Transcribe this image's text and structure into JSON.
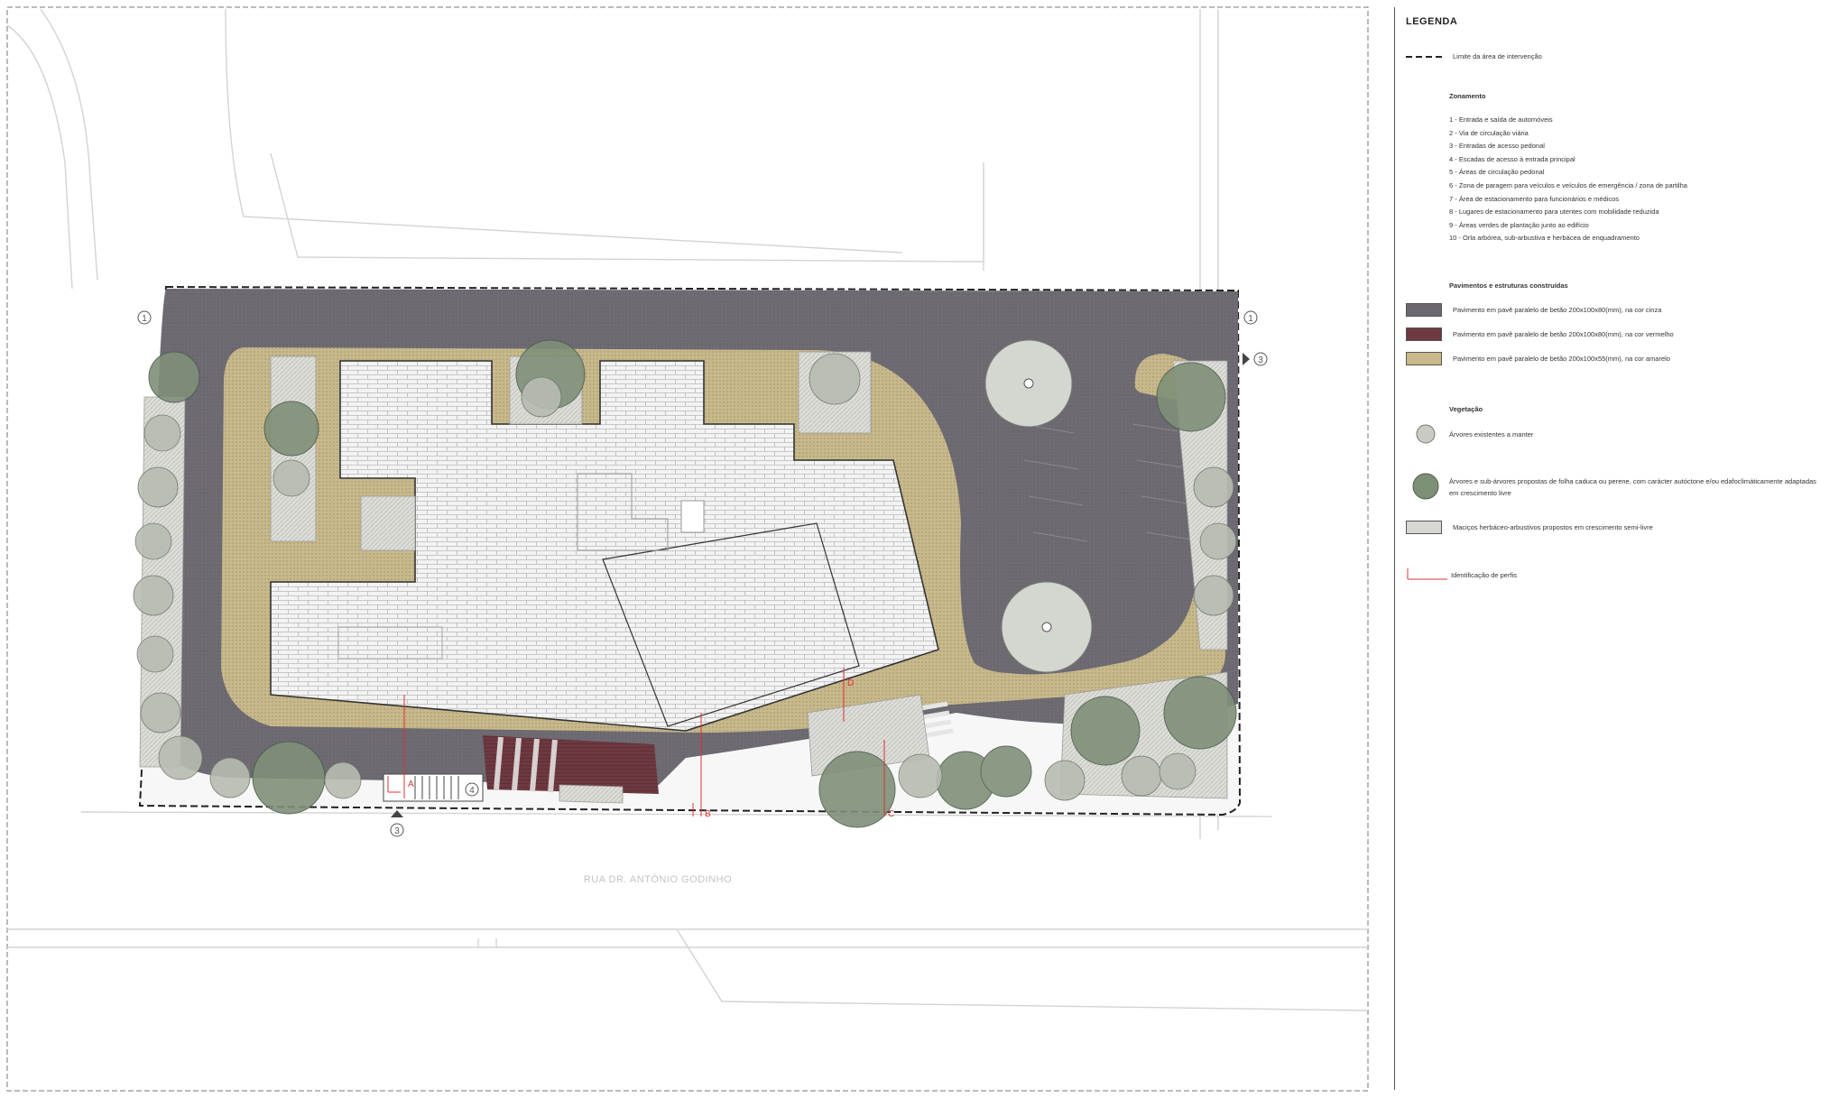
{
  "legend": {
    "title": "LEGENDA",
    "boundary_label": "Limite da área de intervenção",
    "zoning_heading": "Zonamento",
    "zoning_items": [
      "1 - Entrada e saída de automóveis",
      "2 - Via de circulação viária",
      "3 - Entradas de acesso pedonal",
      "4 - Escadas de acesso à entrada principal",
      "5 - Áreas de circulação pedonal",
      "6 - Zona de paragem para veículos e veículos de emergência / zona de partilha",
      "7 - Área de estacionamento para funcionários e médicos",
      "8 - Lugares de estacionamento para utentes com mobilidade reduzida",
      "9 - Áreas verdes de plantação junto ao edifício",
      "10 - Orla arbórea, sub-arbustiva e herbácea de enquadramento"
    ],
    "pavement_heading": "Pavimentos e estruturas construídas",
    "pavements": [
      {
        "label": "Pavimento em pavê paralelo de betão 200x100x80(mm), na cor cinza",
        "color": "#6b6870"
      },
      {
        "label": "Pavimento em pavê paralelo de betão 200x100x80(mm), na cor vermelho",
        "color": "#6e3a40"
      },
      {
        "label": "Pavimento em pavê paralelo de betão 200x100x55(mm), na cor amarelo",
        "color": "#c9b98a"
      }
    ],
    "vegetation_heading": "Vegetação",
    "vegetation": [
      {
        "label": "Árvores existentes a manter"
      },
      {
        "label": "Árvores e sub-árvores propostas de folha caduca ou perene, com carácter autóctone e/ou edafoclimáticamente adaptadas em crescimento livre"
      },
      {
        "label": "Maciços herbáceo-arbustivos propostos em crescimento semi-livre"
      }
    ],
    "profile_label": "Identificação de perfis"
  },
  "plan": {
    "street_name": "RUA DR. ANTÓNIO GODINHO",
    "markers": [
      "1",
      "1",
      "3",
      "3",
      "4"
    ],
    "profiles": [
      "A",
      "B",
      "C",
      "D"
    ],
    "colors": {
      "road": "#6e6b73",
      "red_paving": "#6d3940",
      "yellow_paving": "#c8b98c",
      "building": "#f2f2f2",
      "tree_existing": "#c8cbc4",
      "tree_proposed": "#7e8f78",
      "shrub": "#d6d6d2"
    }
  }
}
